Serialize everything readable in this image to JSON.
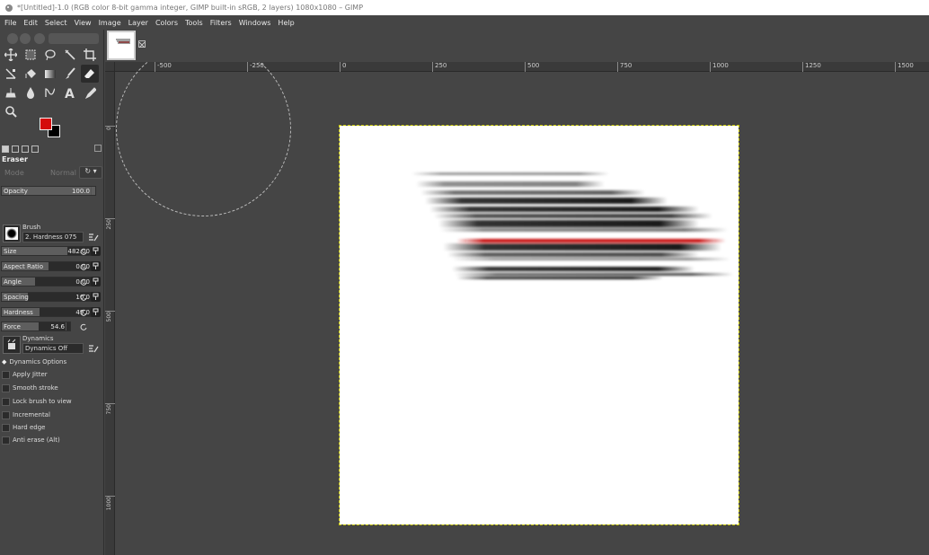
{
  "window": {
    "title": "*[Untitled]-1.0 (RGB color 8-bit gamma integer, GIMP built-in sRGB, 2 layers) 1080x1080 – GIMP"
  },
  "menu": [
    "File",
    "Edit",
    "Select",
    "View",
    "Image",
    "Layer",
    "Colors",
    "Tools",
    "Filters",
    "Windows",
    "Help"
  ],
  "colors": {
    "foreground": "#d40c0c",
    "background": "#000000"
  },
  "tool_options": {
    "title": "Eraser",
    "mode_label": "Mode",
    "mode_value": "Normal",
    "opacity": {
      "label": "Opacity",
      "value": "100.0"
    },
    "brush": {
      "label": "Brush",
      "value": "2. Hardness 075"
    },
    "size": {
      "label": "Size",
      "value": "482.00"
    },
    "aspect_ratio": {
      "label": "Aspect Ratio",
      "value": "0.00"
    },
    "angle": {
      "label": "Angle",
      "value": "0.00"
    },
    "spacing": {
      "label": "Spacing",
      "value": "10.0"
    },
    "hardness": {
      "label": "Hardness",
      "value": "49.0"
    },
    "force": {
      "label": "Force",
      "value": "54.6"
    },
    "dynamics": {
      "label": "Dynamics",
      "value": "Dynamics Off"
    },
    "dynamics_options": "Dynamics Options",
    "checks": [
      "Apply Jitter",
      "Smooth stroke",
      "Lock brush to view",
      "Incremental",
      "Hard edge",
      "Anti erase  (Alt)"
    ]
  },
  "ruler": {
    "h_ticks": [
      "-500",
      "-250",
      "0",
      "250",
      "500",
      "750",
      "1000",
      "1250",
      "1500"
    ],
    "v_ticks": [
      "0",
      "250",
      "500",
      "750",
      "1000"
    ]
  }
}
